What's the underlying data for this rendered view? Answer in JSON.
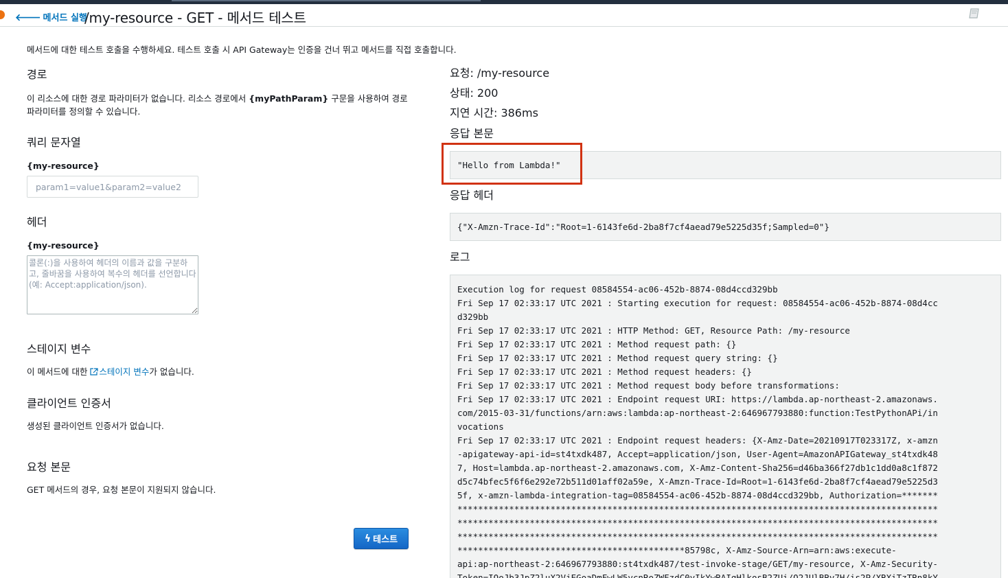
{
  "header": {
    "back_label": "메서드 실행",
    "title": "/my-resource - GET - 메서드 테스트"
  },
  "intro": "메서드에 대한 테스트 호출을 수행하세요. 테스트 호출 시 API Gateway는 인증을 건너 뛰고 메서드를 직접 호출합니다.",
  "path_section": {
    "heading": "경로",
    "text_before": "이 리소스에 대한 경로 파라미터가 없습니다. 리소스 경로에서 ",
    "param_token": "{myPathParam}",
    "text_after": " 구문을 사용하여 경로 파라미터를 정의할 수 있습니다."
  },
  "query_section": {
    "heading": "쿼리 문자열",
    "label": "{my-resource}",
    "placeholder": "param1=value1&param2=value2"
  },
  "headers_section": {
    "heading": "헤더",
    "label": "{my-resource}",
    "placeholder": "콜론(:)을 사용하여 헤더의 이름과 값을 구분하고, 줄바꿈을 사용하여 복수의 헤더를 선언합니다(예: Accept:application/json)."
  },
  "stage_section": {
    "heading": "스테이지 변수",
    "text_before": "이 메서드에 대한 ",
    "link": "스테이지 변수",
    "text_after": "가 없습니다."
  },
  "cert_section": {
    "heading": "클라이언트 인증서",
    "text": "생성된 클라이언트 인증서가 없습니다."
  },
  "body_section": {
    "heading": "요청 본문",
    "text": "GET 메서드의 경우, 요청 본문이 지원되지 않습니다."
  },
  "test_button": "테스트",
  "response": {
    "request_line": "요청: /my-resource",
    "status_line": "상태: 200",
    "latency_line": "지연 시간: 386ms",
    "body_heading": "응답 본문",
    "body": "\"Hello from Lambda!\"",
    "headers_heading": "응답 헤더",
    "headers": "{\"X-Amzn-Trace-Id\":\"Root=1-6143fe6d-2ba8f7cf4aead79e5225d35f;Sampled=0\"}",
    "log_heading": "로그",
    "log": "Execution log for request 08584554-ac06-452b-8874-08d4ccd329bb\nFri Sep 17 02:33:17 UTC 2021 : Starting execution for request: 08584554-ac06-452b-8874-08d4cc\nd329bb\nFri Sep 17 02:33:17 UTC 2021 : HTTP Method: GET, Resource Path: /my-resource\nFri Sep 17 02:33:17 UTC 2021 : Method request path: {}\nFri Sep 17 02:33:17 UTC 2021 : Method request query string: {}\nFri Sep 17 02:33:17 UTC 2021 : Method request headers: {}\nFri Sep 17 02:33:17 UTC 2021 : Method request body before transformations:\nFri Sep 17 02:33:17 UTC 2021 : Endpoint request URI: https://lambda.ap-northeast-2.amazonaws.\ncom/2015-03-31/functions/arn:aws:lambda:ap-northeast-2:646967793880:function:TestPythonAPi/in\nvocations\nFri Sep 17 02:33:17 UTC 2021 : Endpoint request headers: {X-Amz-Date=20210917T023317Z, x-amzn\n-apigateway-api-id=st4txdk487, Accept=application/json, User-Agent=AmazonAPIGateway_st4txdk48\n7, Host=lambda.ap-northeast-2.amazonaws.com, X-Amz-Content-Sha256=d46ba366f27db1c1dd0a8c1f872\nd5c74bfec5f6f6e292e72b511d01aff02a59e, X-Amzn-Trace-Id=Root=1-6143fe6d-2ba8f7cf4aead79e5225d3\n5f, x-amzn-lambda-integration-tag=08584554-ac06-452b-8874-08d4ccd329bb, Authorization=*******\n*********************************************************************************************\n*********************************************************************************************\n*********************************************************************************************\n********************************************85798c, X-Amz-Source-Arn=arn:aws:execute-\napi:ap-northeast-2:646967793880:st4txdk487/test-invoke-stage/GET/my-resource, X-Amz-Security-\nToken=IQoJb3JpZ2luX2VjEGoaDmFwLW5vcnRoZWFzdC0yIkYwRAIgHlkosB2ZUi/O2JUlBRv7H/is2P/XRXiTzTRn8kY"
  },
  "colors": {
    "link": "#0073bb",
    "highlight": "#d13212",
    "button": "#1a73d1"
  }
}
